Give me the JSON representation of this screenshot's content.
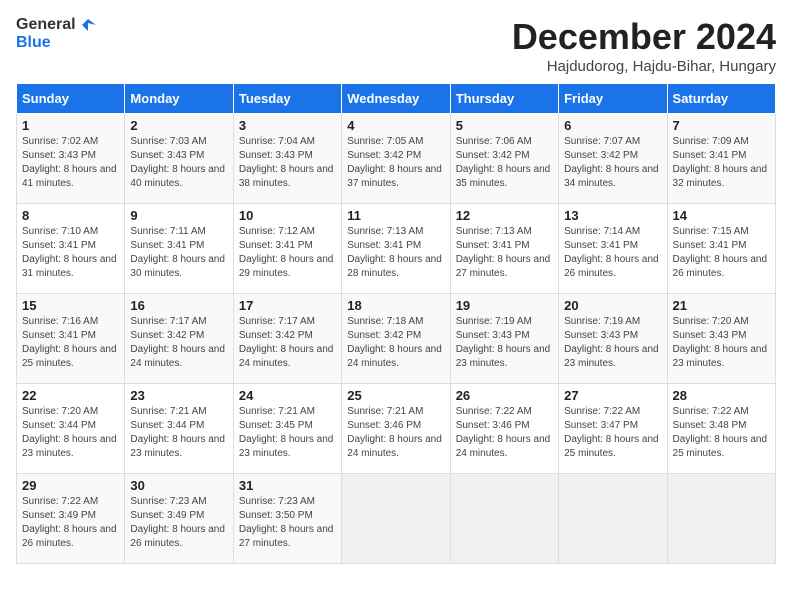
{
  "header": {
    "logo_line1": "General",
    "logo_line2": "Blue",
    "month": "December 2024",
    "location": "Hajdudorog, Hajdu-Bihar, Hungary"
  },
  "days_of_week": [
    "Sunday",
    "Monday",
    "Tuesday",
    "Wednesday",
    "Thursday",
    "Friday",
    "Saturday"
  ],
  "weeks": [
    [
      {
        "day": "1",
        "sunrise": "7:02 AM",
        "sunset": "3:43 PM",
        "daylight": "8 hours and 41 minutes."
      },
      {
        "day": "2",
        "sunrise": "7:03 AM",
        "sunset": "3:43 PM",
        "daylight": "8 hours and 40 minutes."
      },
      {
        "day": "3",
        "sunrise": "7:04 AM",
        "sunset": "3:43 PM",
        "daylight": "8 hours and 38 minutes."
      },
      {
        "day": "4",
        "sunrise": "7:05 AM",
        "sunset": "3:42 PM",
        "daylight": "8 hours and 37 minutes."
      },
      {
        "day": "5",
        "sunrise": "7:06 AM",
        "sunset": "3:42 PM",
        "daylight": "8 hours and 35 minutes."
      },
      {
        "day": "6",
        "sunrise": "7:07 AM",
        "sunset": "3:42 PM",
        "daylight": "8 hours and 34 minutes."
      },
      {
        "day": "7",
        "sunrise": "7:09 AM",
        "sunset": "3:41 PM",
        "daylight": "8 hours and 32 minutes."
      }
    ],
    [
      {
        "day": "8",
        "sunrise": "7:10 AM",
        "sunset": "3:41 PM",
        "daylight": "8 hours and 31 minutes."
      },
      {
        "day": "9",
        "sunrise": "7:11 AM",
        "sunset": "3:41 PM",
        "daylight": "8 hours and 30 minutes."
      },
      {
        "day": "10",
        "sunrise": "7:12 AM",
        "sunset": "3:41 PM",
        "daylight": "8 hours and 29 minutes."
      },
      {
        "day": "11",
        "sunrise": "7:13 AM",
        "sunset": "3:41 PM",
        "daylight": "8 hours and 28 minutes."
      },
      {
        "day": "12",
        "sunrise": "7:13 AM",
        "sunset": "3:41 PM",
        "daylight": "8 hours and 27 minutes."
      },
      {
        "day": "13",
        "sunrise": "7:14 AM",
        "sunset": "3:41 PM",
        "daylight": "8 hours and 26 minutes."
      },
      {
        "day": "14",
        "sunrise": "7:15 AM",
        "sunset": "3:41 PM",
        "daylight": "8 hours and 26 minutes."
      }
    ],
    [
      {
        "day": "15",
        "sunrise": "7:16 AM",
        "sunset": "3:41 PM",
        "daylight": "8 hours and 25 minutes."
      },
      {
        "day": "16",
        "sunrise": "7:17 AM",
        "sunset": "3:42 PM",
        "daylight": "8 hours and 24 minutes."
      },
      {
        "day": "17",
        "sunrise": "7:17 AM",
        "sunset": "3:42 PM",
        "daylight": "8 hours and 24 minutes."
      },
      {
        "day": "18",
        "sunrise": "7:18 AM",
        "sunset": "3:42 PM",
        "daylight": "8 hours and 24 minutes."
      },
      {
        "day": "19",
        "sunrise": "7:19 AM",
        "sunset": "3:43 PM",
        "daylight": "8 hours and 23 minutes."
      },
      {
        "day": "20",
        "sunrise": "7:19 AM",
        "sunset": "3:43 PM",
        "daylight": "8 hours and 23 minutes."
      },
      {
        "day": "21",
        "sunrise": "7:20 AM",
        "sunset": "3:43 PM",
        "daylight": "8 hours and 23 minutes."
      }
    ],
    [
      {
        "day": "22",
        "sunrise": "7:20 AM",
        "sunset": "3:44 PM",
        "daylight": "8 hours and 23 minutes."
      },
      {
        "day": "23",
        "sunrise": "7:21 AM",
        "sunset": "3:44 PM",
        "daylight": "8 hours and 23 minutes."
      },
      {
        "day": "24",
        "sunrise": "7:21 AM",
        "sunset": "3:45 PM",
        "daylight": "8 hours and 23 minutes."
      },
      {
        "day": "25",
        "sunrise": "7:21 AM",
        "sunset": "3:46 PM",
        "daylight": "8 hours and 24 minutes."
      },
      {
        "day": "26",
        "sunrise": "7:22 AM",
        "sunset": "3:46 PM",
        "daylight": "8 hours and 24 minutes."
      },
      {
        "day": "27",
        "sunrise": "7:22 AM",
        "sunset": "3:47 PM",
        "daylight": "8 hours and 25 minutes."
      },
      {
        "day": "28",
        "sunrise": "7:22 AM",
        "sunset": "3:48 PM",
        "daylight": "8 hours and 25 minutes."
      }
    ],
    [
      {
        "day": "29",
        "sunrise": "7:22 AM",
        "sunset": "3:49 PM",
        "daylight": "8 hours and 26 minutes."
      },
      {
        "day": "30",
        "sunrise": "7:23 AM",
        "sunset": "3:49 PM",
        "daylight": "8 hours and 26 minutes."
      },
      {
        "day": "31",
        "sunrise": "7:23 AM",
        "sunset": "3:50 PM",
        "daylight": "8 hours and 27 minutes."
      },
      null,
      null,
      null,
      null
    ]
  ]
}
